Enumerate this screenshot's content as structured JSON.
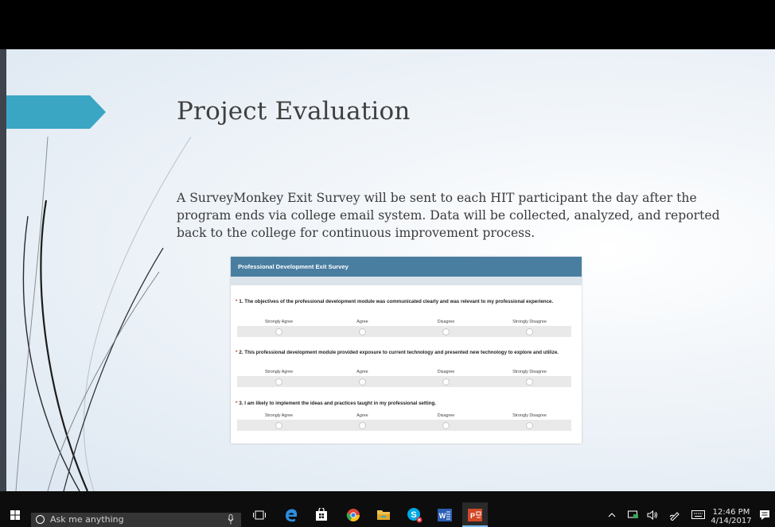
{
  "slide": {
    "title": "Project Evaluation",
    "body": "A SurveyMonkey Exit Survey will be sent to each HIT participant the day after the program ends via college email system. Data will be collected, analyzed, and reported back to the college for continuous improvement process."
  },
  "survey": {
    "header": "Professional Development Exit Survey",
    "required_mark": "*",
    "choice_labels": [
      "Strongly Agree",
      "Agree",
      "Disagree",
      "Strongly Disagree"
    ],
    "questions": [
      {
        "text": "1. The objectives of the professional development module was communicated clearly and was relevant to my professional experience."
      },
      {
        "text": "2. This professional development module provided exposure to current technology and presented new technology to explore and utilize."
      },
      {
        "text": "3. I am likely to implement the ideas and practices taught in my professional setting."
      }
    ]
  },
  "taskbar": {
    "search_placeholder": "Ask me anything",
    "apps": [
      "start-icon",
      "task-view-icon",
      "edge-icon",
      "store-icon",
      "chrome-icon",
      "file-explorer-icon",
      "skype-icon",
      "word-icon",
      "powerpoint-icon"
    ],
    "time": "12:46 PM",
    "date": "4/14/2017"
  },
  "colors": {
    "accent_teal": "#3aa6c4",
    "survey_header": "#4a7ea0",
    "taskbar": "#0d0d0d"
  }
}
